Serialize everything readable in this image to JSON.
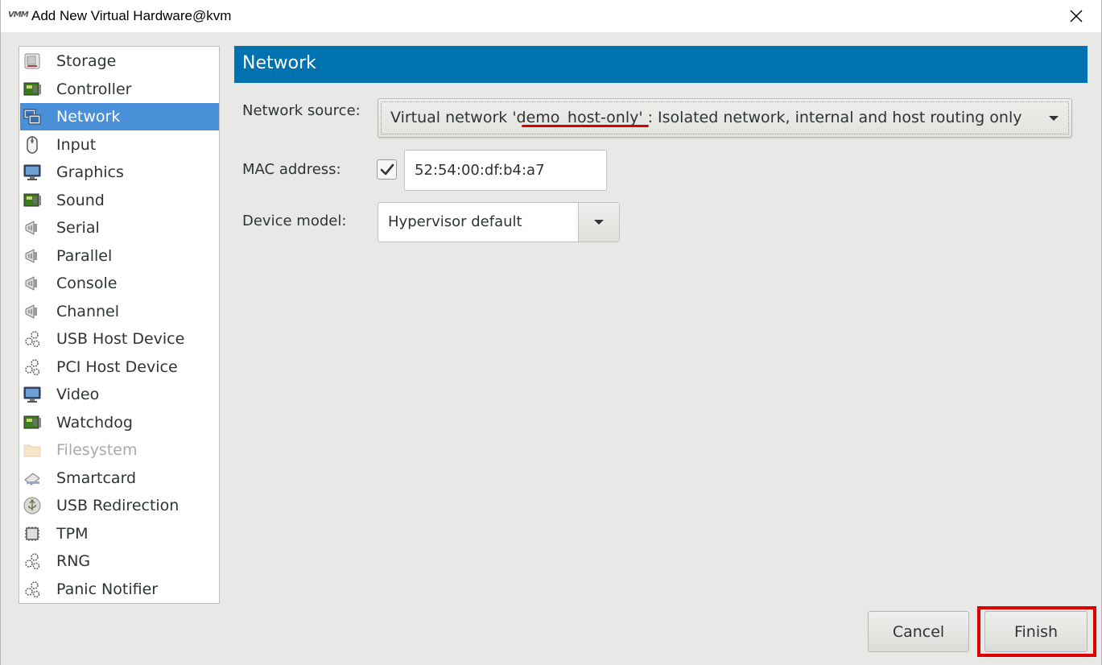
{
  "window": {
    "title": "Add New Virtual Hardware@kvm",
    "app_icon": "vmm-logo",
    "app_icon_text": "VMM"
  },
  "sidebar": {
    "items": [
      {
        "label": "Storage",
        "icon": "storage-icon"
      },
      {
        "label": "Controller",
        "icon": "controller-icon"
      },
      {
        "label": "Network",
        "icon": "network-icon",
        "selected": true
      },
      {
        "label": "Input",
        "icon": "mouse-icon"
      },
      {
        "label": "Graphics",
        "icon": "monitor-icon"
      },
      {
        "label": "Sound",
        "icon": "sound-card-icon"
      },
      {
        "label": "Serial",
        "icon": "serial-port-icon"
      },
      {
        "label": "Parallel",
        "icon": "parallel-port-icon"
      },
      {
        "label": "Console",
        "icon": "console-port-icon"
      },
      {
        "label": "Channel",
        "icon": "channel-port-icon"
      },
      {
        "label": "USB Host Device",
        "icon": "usb-host-device-icon"
      },
      {
        "label": "PCI Host Device",
        "icon": "pci-host-device-icon"
      },
      {
        "label": "Video",
        "icon": "video-monitor-icon"
      },
      {
        "label": "Watchdog",
        "icon": "watchdog-card-icon"
      },
      {
        "label": "Filesystem",
        "icon": "folder-icon",
        "disabled": true
      },
      {
        "label": "Smartcard",
        "icon": "smartcard-icon"
      },
      {
        "label": "USB Redirection",
        "icon": "usb-redirection-icon"
      },
      {
        "label": "TPM",
        "icon": "tpm-chip-icon"
      },
      {
        "label": "RNG",
        "icon": "rng-icon"
      },
      {
        "label": "Panic Notifier",
        "icon": "panic-notifier-icon"
      }
    ]
  },
  "panel": {
    "title": "Network",
    "network_source": {
      "label": "Network source:",
      "value": "Virtual network 'demo_host-only' : Isolated network, internal and host routing only"
    },
    "mac_address": {
      "label": "MAC address:",
      "checked": true,
      "value": "52:54:00:df:b4:a7"
    },
    "device_model": {
      "label": "Device model:",
      "value": "Hypervisor default"
    }
  },
  "buttons": {
    "cancel": "Cancel",
    "finish": "Finish"
  },
  "annotations": {
    "underline_color": "#d50000",
    "highlight_color": "#e00000"
  }
}
